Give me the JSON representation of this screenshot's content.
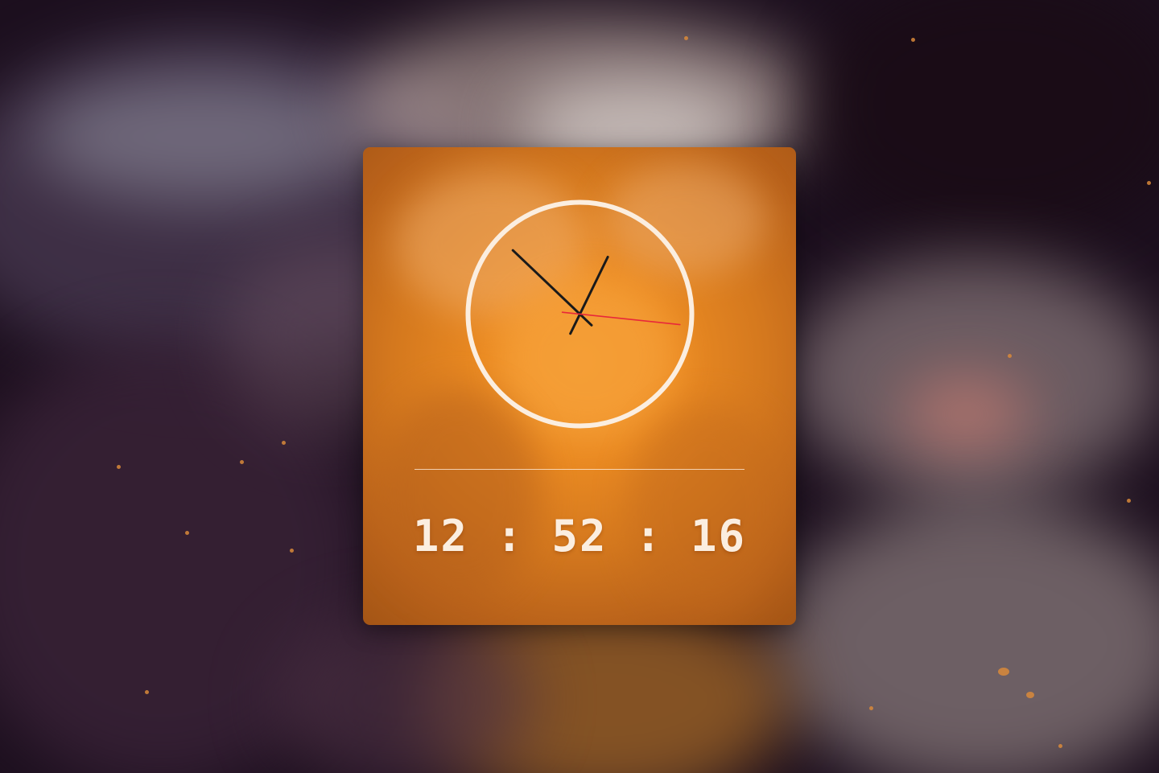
{
  "clock": {
    "digital_time": "12 : 52 : 16",
    "hours": 12,
    "minutes": 52,
    "seconds": 16
  },
  "colors": {
    "card_accent": "#ea8a22",
    "ring": "#fbeee0",
    "hour_minute_hands": "#1a1a1a",
    "second_hand": "#e8283a",
    "digital_text": "#fbeee0"
  },
  "icons": {
    "background": "abstract-fluid-art-background"
  }
}
